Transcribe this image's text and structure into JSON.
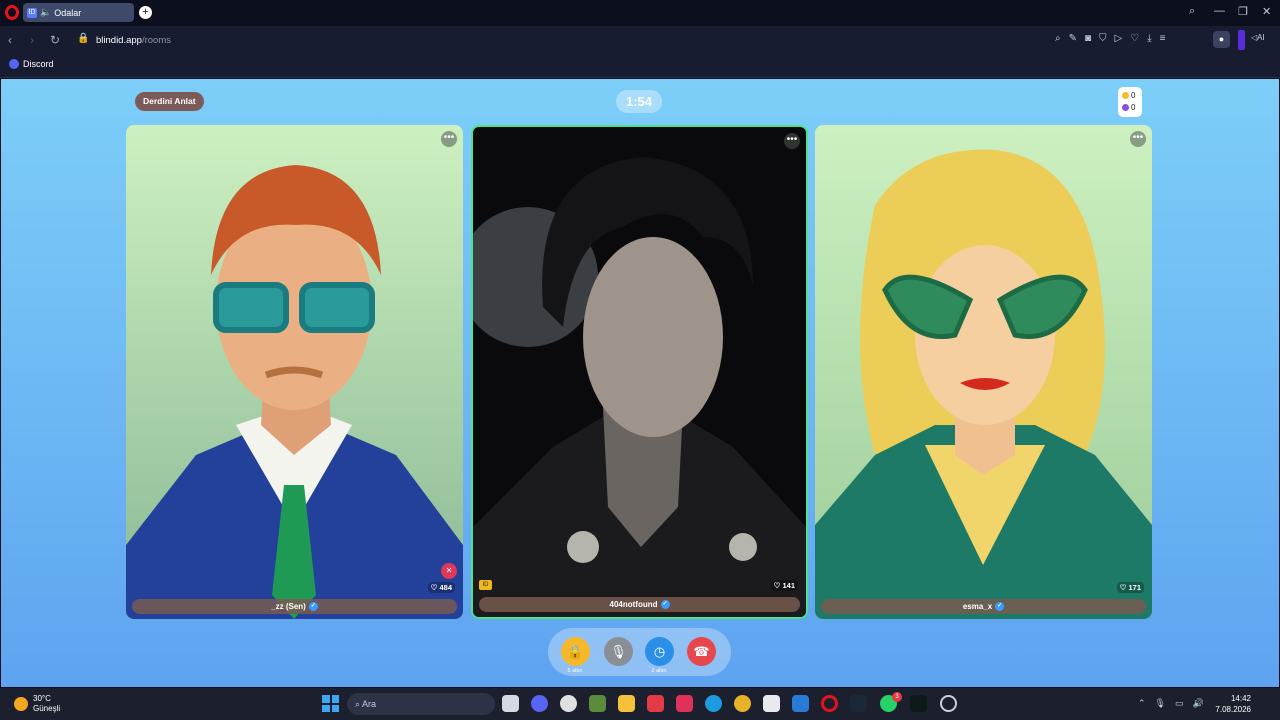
{
  "browser": {
    "tab_title": "Odalar",
    "tab_favicon": "ID",
    "url_domain": "blindid.app",
    "url_path": "/rooms",
    "bookmark": "Discord",
    "ai_label": "AI"
  },
  "room": {
    "topic_pill": "Derdini Anlat",
    "timer": "1:54",
    "coins_gold": "0",
    "coins_purple": "0"
  },
  "participants": [
    {
      "name": "_zz (Sen)",
      "likes": "484",
      "muted": true,
      "accent": "#cdf0c0"
    },
    {
      "name": "404notfound",
      "likes": "141",
      "muted": false,
      "accent": "#4de08f"
    },
    {
      "name": "esma_x",
      "likes": "171",
      "muted": false,
      "accent": "#cdf0c0"
    }
  ],
  "controls": {
    "lock_label": "5 altın",
    "timer_label": "2 altın"
  },
  "taskbar": {
    "temperature": "30°C",
    "weather_text": "Güneşli",
    "search_placeholder": "Ara",
    "time": "14:42",
    "date": "7.08.2026",
    "whatsapp_badge": "3"
  },
  "colors": {
    "page_top": "#7dcef8",
    "page_bottom": "#5ea3f0",
    "lock": "#f5b82a",
    "timer": "#2b8fe8",
    "hangup": "#e8464d"
  }
}
